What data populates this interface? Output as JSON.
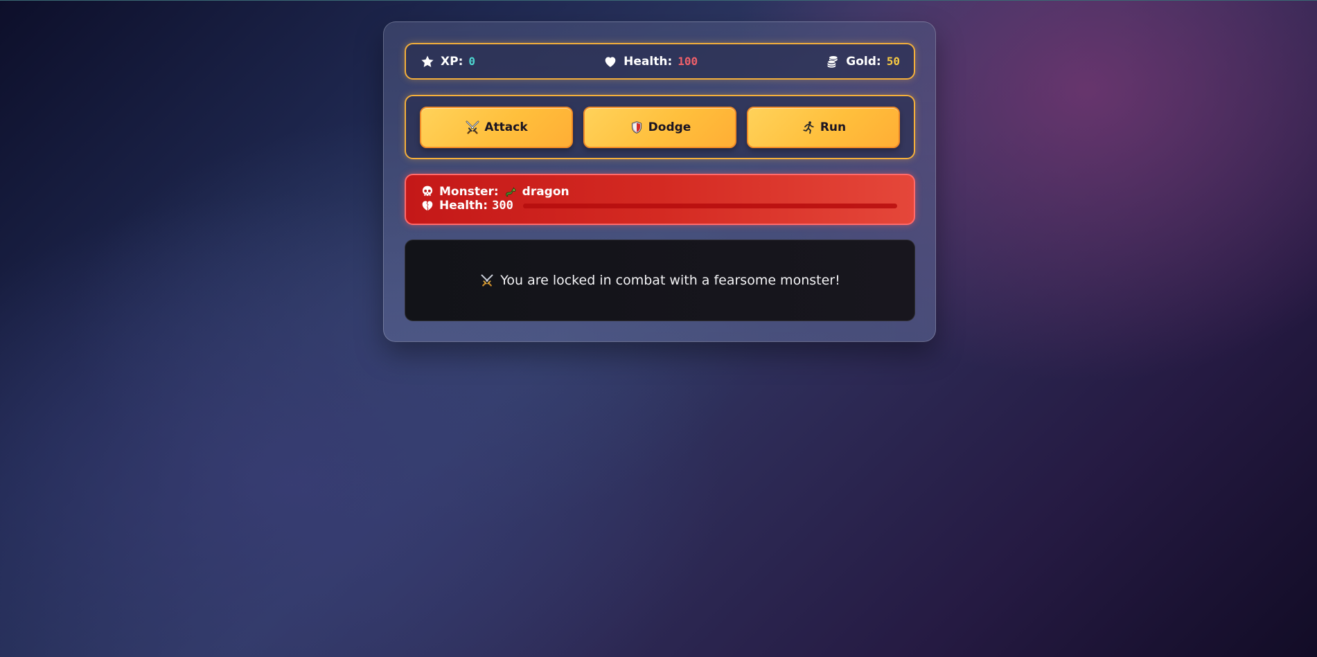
{
  "stats": {
    "xp": {
      "icon": "star-icon",
      "label": "XP:",
      "value": "0",
      "color": "#4dd6d0"
    },
    "health": {
      "icon": "heart-icon",
      "label": "Health:",
      "value": "100",
      "color": "#f0606a"
    },
    "gold": {
      "icon": "coins-icon",
      "label": "Gold:",
      "value": "50",
      "color": "#f6c942"
    }
  },
  "controls": {
    "attack": {
      "icon": "crossed-swords-icon",
      "label": "Attack"
    },
    "dodge": {
      "icon": "shield-icon",
      "label": "Dodge"
    },
    "run": {
      "icon": "runner-icon",
      "label": "Run"
    }
  },
  "monster": {
    "name_label": "Monster:",
    "name_icon": "dragon-icon",
    "name": "dragon",
    "health_label": "Health:",
    "health_value": "300",
    "health_fraction": 1.0,
    "panel_color": "#d42a22"
  },
  "message": {
    "icon": "crossed-swords-icon",
    "text": "You are locked in combat with a fearsome monster!"
  },
  "colors": {
    "accent_border": "#f5b03b",
    "button_fill": "#ffbf3c",
    "message_bg": "#121318"
  }
}
